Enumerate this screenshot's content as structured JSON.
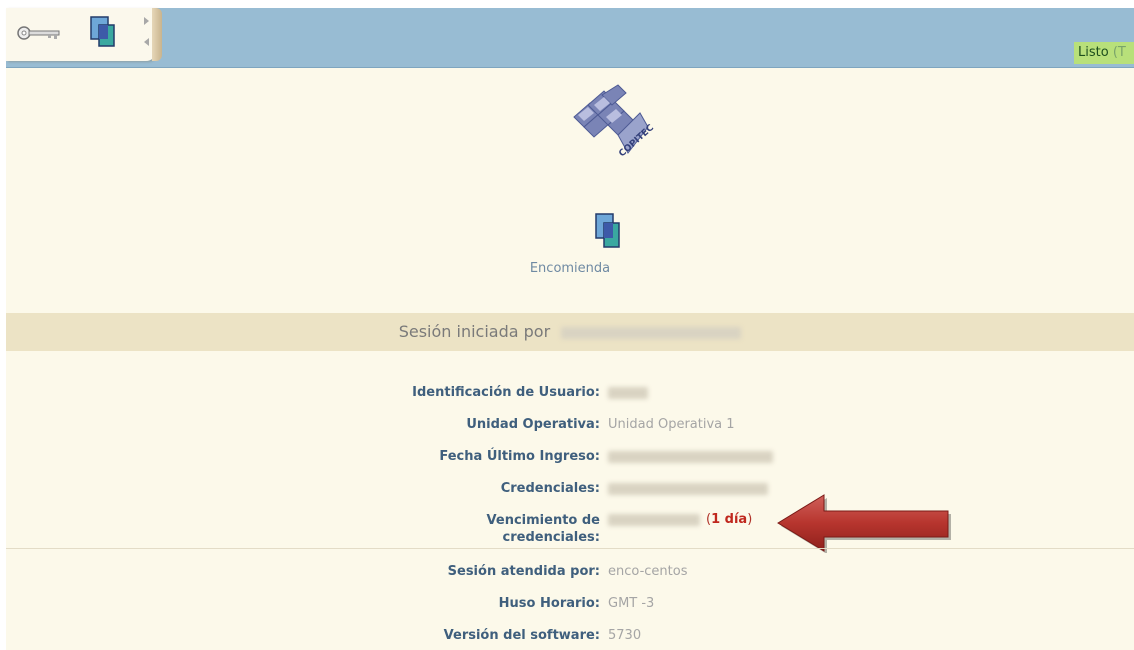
{
  "toolbar": {
    "key_icon": "key-icon",
    "app_icon": "encomienda-icon",
    "status_label": "Listo",
    "status_paren": "(T"
  },
  "branding": {
    "logo_text": "COPITEC"
  },
  "app": {
    "name": "Encomienda"
  },
  "session": {
    "started_by_label": "Sesión iniciada por"
  },
  "user_details": [
    {
      "label": "Identificación de Usuario:",
      "value": ""
    },
    {
      "label": "Unidad Operativa:",
      "value": "Unidad Operativa 1"
    },
    {
      "label": "Fecha Último Ingreso:",
      "value": ""
    },
    {
      "label": "Credenciales:",
      "value": ""
    }
  ],
  "expiry": {
    "label_line1": "Vencimiento de",
    "label_line2": "credenciales:",
    "open_paren": "(",
    "days": "1 día",
    "close_paren": ")"
  },
  "server_details": [
    {
      "label": "Sesión atendida por:",
      "value": "enco-centos"
    },
    {
      "label": "Huso Horario:",
      "value": "GMT -3"
    },
    {
      "label": "Versión del software:",
      "value": "5730"
    }
  ],
  "colors": {
    "topbar": "#98bcd3",
    "background": "#fcf9ea",
    "session_bar": "#ece3c5",
    "label_text": "#3f5f7d",
    "status_bg": "#b8e07a",
    "warning": "#c0281e"
  }
}
